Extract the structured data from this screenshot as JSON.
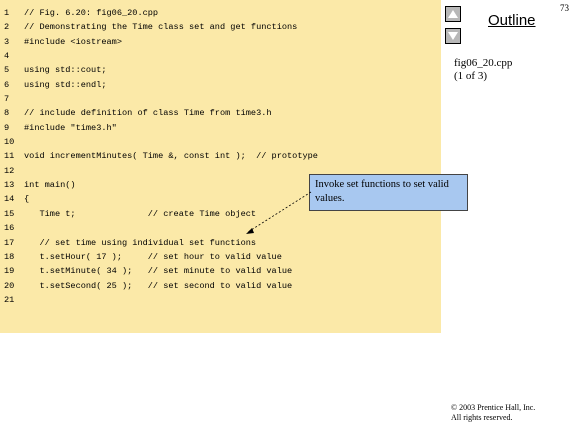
{
  "page_number": "73",
  "outline": {
    "title": "Outline",
    "nav_up": "up-arrow",
    "nav_down": "down-arrow",
    "file_name": "fig06_20.cpp",
    "file_part": "(1 of 3)"
  },
  "code": [
    {
      "n": "1",
      "text": "// Fig. 6.20: fig06_20.cpp"
    },
    {
      "n": "2",
      "text": "// Demonstrating the Time class set and get functions"
    },
    {
      "n": "3",
      "text": "#include <iostream>"
    },
    {
      "n": "4",
      "text": ""
    },
    {
      "n": "5",
      "text": "using std::cout;"
    },
    {
      "n": "6",
      "text": "using std::endl;"
    },
    {
      "n": "7",
      "text": ""
    },
    {
      "n": "8",
      "text": "// include definition of class Time from time3.h"
    },
    {
      "n": "9",
      "text": "#include \"time3.h\""
    },
    {
      "n": "10",
      "text": ""
    },
    {
      "n": "11",
      "text": "void incrementMinutes( Time &, const int );  // prototype"
    },
    {
      "n": "12",
      "text": ""
    },
    {
      "n": "13",
      "text": "int main()"
    },
    {
      "n": "14",
      "text": "{"
    },
    {
      "n": "15",
      "text": "   Time t;              // create Time object"
    },
    {
      "n": "16",
      "text": ""
    },
    {
      "n": "17",
      "text": "   // set time using individual set functions"
    },
    {
      "n": "18",
      "text": "   t.setHour( 17 );     // set hour to valid value"
    },
    {
      "n": "19",
      "text": "   t.setMinute( 34 );   // set minute to valid value"
    },
    {
      "n": "20",
      "text": "   t.setSecond( 25 );   // set second to valid value"
    },
    {
      "n": "21",
      "text": ""
    }
  ],
  "callout": {
    "text": "Invoke set functions to set valid values."
  },
  "copyright": {
    "line1": "© 2003 Prentice Hall, Inc.",
    "line2": "All rights reserved."
  },
  "colors": {
    "code_background": "#fbe9a8",
    "callout_background": "#a8c8f0"
  }
}
